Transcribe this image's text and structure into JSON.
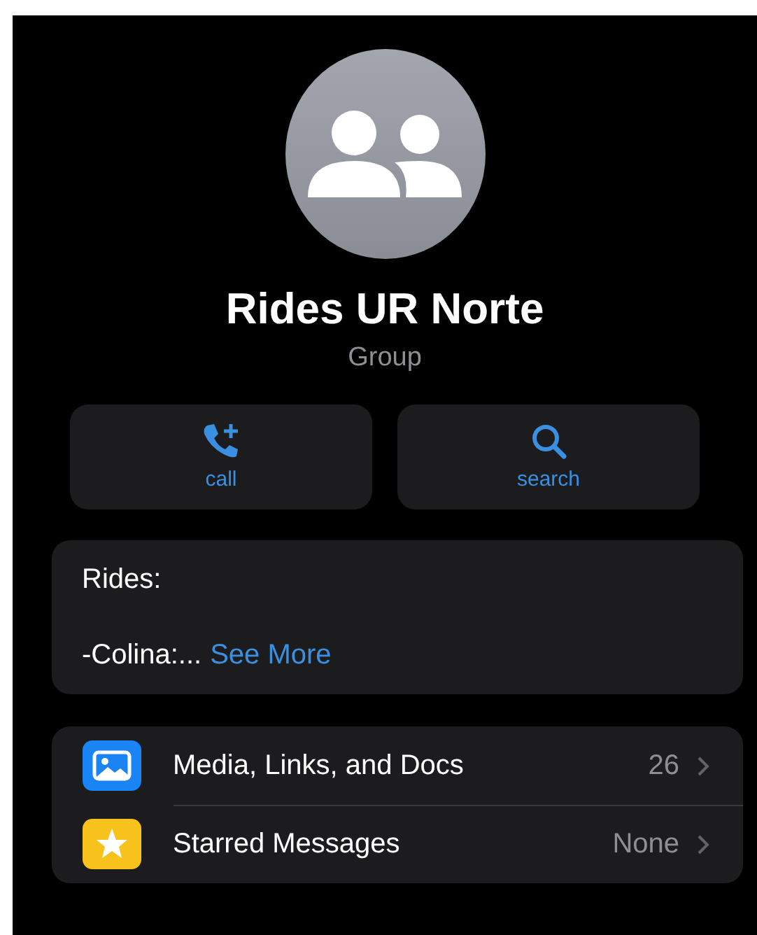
{
  "group": {
    "name": "Rides UR Norte",
    "subtitle": "Group"
  },
  "actions": [
    {
      "kind": "call",
      "label": "call"
    },
    {
      "kind": "search",
      "label": "search"
    }
  ],
  "description": {
    "lines": [
      "Rides:",
      "-Colina:..."
    ],
    "more_link": "See More"
  },
  "rows": [
    {
      "kind": "media",
      "label": "Media, Links, and Docs",
      "value": "26"
    },
    {
      "kind": "starred",
      "label": "Starred Messages",
      "value": "None"
    }
  ]
}
